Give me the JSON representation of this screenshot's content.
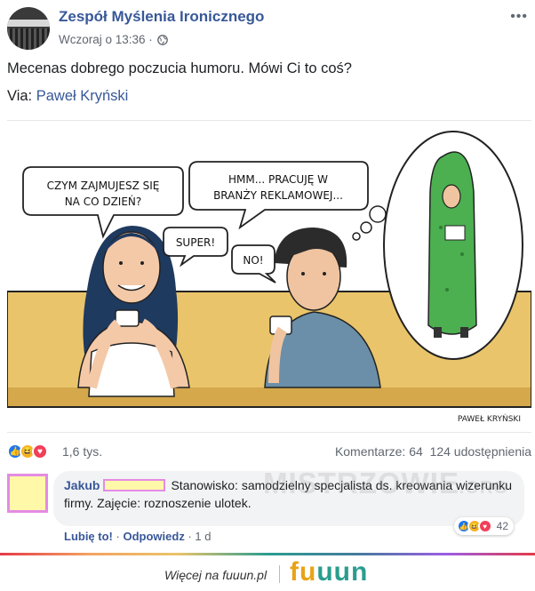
{
  "post": {
    "page_name": "Zespół Myślenia Ironicznego",
    "time": "Wczoraj o 13:36 ·",
    "text": "Mecenas dobrego poczucia humoru. Mówi Ci to coś?",
    "via_label": "Via: ",
    "via_author": "Paweł Kryński",
    "avatar_caption": "",
    "more_icon": "more-options-icon",
    "privacy_icon": "globe-icon"
  },
  "comic": {
    "bubble_woman_line1": "CZYM ZAJMUJESZ SIĘ",
    "bubble_woman_line2": "NA CO DZIEŃ?",
    "bubble_man_line1": "HMM... PRACUJĘ W",
    "bubble_man_line2": "BRANŻY REKLAMOWEJ...",
    "bubble_super": "SUPER!",
    "bubble_no": "NO!",
    "signature": "PAWEŁ KRYŃSKI"
  },
  "stats": {
    "reaction_icons": [
      "like-icon",
      "haha-icon",
      "love-icon"
    ],
    "reaction_count": "1,6 tys.",
    "comments": "Komentarze: 64",
    "shares": "124 udostępnienia"
  },
  "comment": {
    "author": "Jakub",
    "text": "Stanowisko: samodzielny specjalista ds. kreowania wizerunku firmy. Zajęcie: roznoszenie ulotek.",
    "like_label": "Lubię to!",
    "reply_label": "Odpowiedz",
    "age": "1 d",
    "separator": "·",
    "reaction_count": "42",
    "watermark": "MISTRZOWIE",
    "watermark_tld": ".ORG"
  },
  "footer": {
    "text": "Więcej na fuuun.pl",
    "logo_part1": "fu",
    "logo_part2": "uun"
  },
  "colors": {
    "link_blue": "#385898",
    "like_blue": "#1877f2",
    "love_red": "#f33e58",
    "haha_yellow": "#f7b125",
    "comic_table": "#e9c46a",
    "cucumber_green": "#4caf50"
  }
}
